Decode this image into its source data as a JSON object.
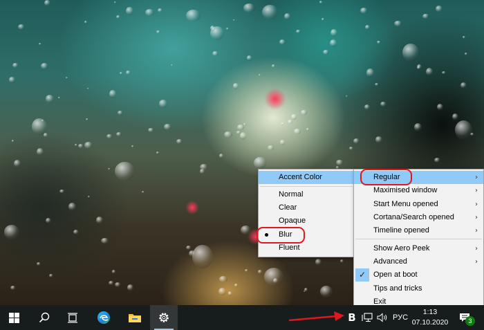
{
  "submenu": {
    "items": [
      {
        "label": "Accent Color"
      },
      {
        "label": "Normal"
      },
      {
        "label": "Clear"
      },
      {
        "label": "Opaque"
      },
      {
        "label": "Blur",
        "selected": true
      },
      {
        "label": "Fluent"
      }
    ]
  },
  "main_menu": {
    "items": [
      {
        "label": "Regular",
        "has_submenu": true,
        "highlighted": true
      },
      {
        "label": "Maximised window",
        "has_submenu": true
      },
      {
        "label": "Start Menu opened",
        "has_submenu": true
      },
      {
        "label": "Cortana/Search opened",
        "has_submenu": true
      },
      {
        "label": "Timeline opened",
        "has_submenu": true
      },
      {
        "label": "Show Aero Peek",
        "has_submenu": true
      },
      {
        "label": "Advanced",
        "has_submenu": true
      },
      {
        "label": "Open at boot",
        "checked": true
      },
      {
        "label": "Tips and tricks"
      },
      {
        "label": "Exit"
      }
    ]
  },
  "taskbar": {
    "pinned": [
      "start-icon",
      "search-icon",
      "task-view-icon",
      "edge-icon",
      "file-explorer-icon",
      "settings-icon"
    ],
    "tray": {
      "translucenttb_icon_letter": "B",
      "language": "РУС",
      "time": "1:13",
      "date": "07.10.2020",
      "notification_count": "3"
    }
  },
  "colors": {
    "menu_highlight": "#91c9f7",
    "annotation_red": "#e0171f",
    "taskbar": "#171c1d"
  }
}
